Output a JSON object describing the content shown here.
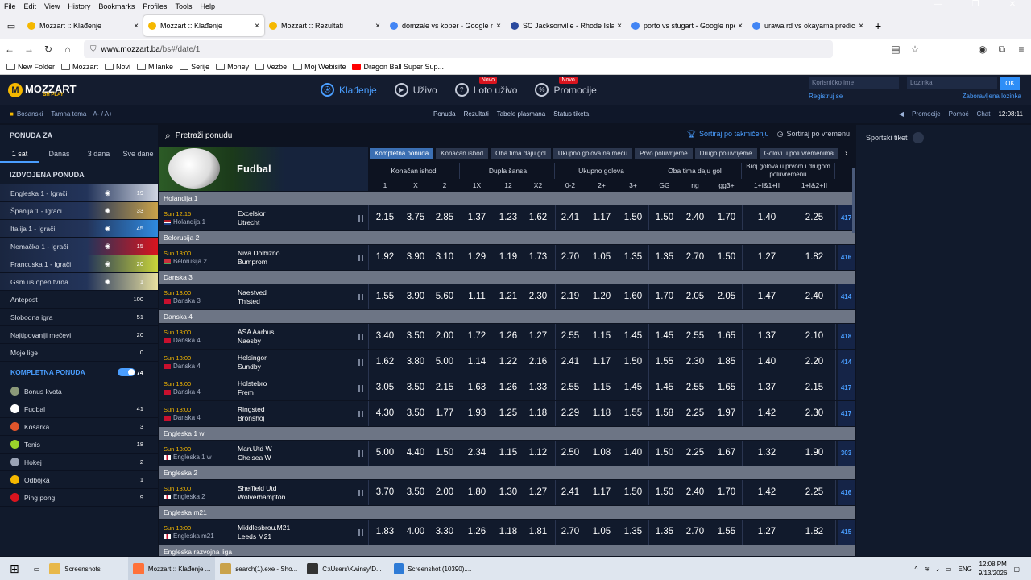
{
  "browser": {
    "menu": [
      "File",
      "Edit",
      "View",
      "History",
      "Bookmarks",
      "Profiles",
      "Tools",
      "Help"
    ],
    "tabs": [
      {
        "title": "Mozzart :: Klađenje",
        "color": "#f5b800"
      },
      {
        "title": "Mozzart :: Klađenje",
        "color": "#f5b800",
        "active": true
      },
      {
        "title": "Mozzart :: Rezultati",
        "color": "#f5b800"
      },
      {
        "title": "domzale vs koper - Google nper",
        "color": "#4285f4"
      },
      {
        "title": "SC Jacksonville - Rhode Island F",
        "color": "#2b4a9e"
      },
      {
        "title": "porto vs stugart - Google nperj",
        "color": "#4285f4"
      },
      {
        "title": "urawa rd vs okayama prediction",
        "color": "#4285f4"
      }
    ],
    "url_host": "www.mozzart.ba",
    "url_path": "/bs#/date/1",
    "bookmarks": [
      "New Folder",
      "Mozzart",
      "Novi",
      "Milanke",
      "Serije",
      "Money",
      "Vezbe",
      "Moj Webisite",
      "Dragon Ball Super Sup..."
    ]
  },
  "site": {
    "logo": "MOZZART",
    "logo_sub": "BH PLAY",
    "nav": [
      {
        "label": "Klađenje",
        "active": true,
        "novo": false
      },
      {
        "label": "Uživo",
        "active": false,
        "novo": false
      },
      {
        "label": "Loto uživo",
        "active": false,
        "novo": true
      },
      {
        "label": "Promocije",
        "active": false,
        "novo": true
      }
    ],
    "novo_label": "Novo",
    "username_placeholder": "Korisničko ime",
    "password_placeholder": "Lozinka",
    "ok": "OK",
    "register": "Registruj se",
    "forgot": "Zaboravljena lozinka",
    "lang": "Bosanski",
    "theme": "Tamna tema",
    "font_size": "A- / A+",
    "subnav": [
      "Ponuda",
      "Rezultati",
      "Tabele plasmana",
      "Status tiketa"
    ],
    "right_links": [
      "Promocije",
      "Pomoć",
      "Chat"
    ],
    "clock": "12:08:11"
  },
  "sidebar": {
    "title": "PONUDA ZA",
    "periods": [
      "1 sat",
      "Danas",
      "3 dana",
      "Sve dane"
    ],
    "featured_title": "IZDVOJENA PONUDA",
    "featured": [
      {
        "label": "Engleska 1 - Igrači",
        "count": "19"
      },
      {
        "label": "Španija 1 - Igrači",
        "count": "33"
      },
      {
        "label": "Italija 1 - Igrači",
        "count": "45"
      },
      {
        "label": "Nemačka 1 - Igrači",
        "count": "15"
      },
      {
        "label": "Francuska 1 - Igrači",
        "count": "20"
      },
      {
        "label": "Gsm us open tvrda",
        "count": "1"
      },
      {
        "label": "Antepost",
        "count": "100"
      },
      {
        "label": "Slobodna igra",
        "count": "51"
      },
      {
        "label": "Najtipovaniji mečevi",
        "count": "20"
      },
      {
        "label": "Moje lige",
        "count": "0"
      }
    ],
    "full_title": "KOMPLETNA PONUDA",
    "full_count": "74",
    "sports": [
      {
        "label": "Bonus kvota",
        "count": "",
        "color": "#8c9a7a"
      },
      {
        "label": "Fudbal",
        "count": "41",
        "color": "#ffffff"
      },
      {
        "label": "Košarka",
        "count": "3",
        "color": "#e0552b"
      },
      {
        "label": "Tenis",
        "count": "18",
        "color": "#9bd32b"
      },
      {
        "label": "Hokej",
        "count": "2",
        "color": "#9aa3b5"
      },
      {
        "label": "Odbojka",
        "count": "1",
        "color": "#f5b800"
      },
      {
        "label": "Ping pong",
        "count": "9",
        "color": "#d9141e"
      }
    ]
  },
  "main": {
    "search": "Pretraži ponudu",
    "sort1": "Sortiraj po takmičenju",
    "sort2": "Sortiraj po vremenu",
    "sport": "Fudbal",
    "markets": [
      "Kompletna ponuda",
      "Konačan ishod",
      "Oba tima daju gol",
      "Ukupno golova na meču",
      "Prvo poluvrijeme",
      "Drugo poluvrijeme",
      "Golovi u poluvremenima"
    ],
    "groups": [
      "Konačan ishod",
      "Dupla šansa",
      "Ukupno golova",
      "Oba tima daju gol",
      "Broj golova u prvom i drugom poluvremenu"
    ],
    "cols": [
      "1",
      "X",
      "2",
      "1X",
      "12",
      "X2",
      "0-2",
      "2+",
      "3+",
      "GG",
      "ng",
      "gg3+",
      "1+I&1+II",
      "1+I&2+II"
    ],
    "leagues": [
      {
        "name": "Holandija 1",
        "events": [
          {
            "time": "Sun 12:15",
            "league": "Holandija 1",
            "flag": "nl",
            "home": "Excelsior",
            "away": "Utrecht",
            "odds": [
              "2.15",
              "3.75",
              "2.85",
              "1.37",
              "1.23",
              "1.62",
              "2.41",
              "1.17",
              "1.50",
              "1.50",
              "2.40",
              "1.70",
              "1.40",
              "2.25"
            ],
            "more": "417"
          }
        ]
      },
      {
        "name": "Belorusija 2",
        "events": [
          {
            "time": "Sun 13:00",
            "league": "Belorusija 2",
            "flag": "by",
            "home": "Niva Dolbizno",
            "away": "Bumprom",
            "odds": [
              "1.92",
              "3.90",
              "3.10",
              "1.29",
              "1.19",
              "1.73",
              "2.70",
              "1.05",
              "1.35",
              "1.35",
              "2.70",
              "1.50",
              "1.27",
              "1.82"
            ],
            "more": "416"
          }
        ]
      },
      {
        "name": "Danska 3",
        "events": [
          {
            "time": "Sun 13:00",
            "league": "Danska 3",
            "flag": "dk",
            "home": "Naestved",
            "away": "Thisted",
            "odds": [
              "1.55",
              "3.90",
              "5.60",
              "1.11",
              "1.21",
              "2.30",
              "2.19",
              "1.20",
              "1.60",
              "1.70",
              "2.05",
              "2.05",
              "1.47",
              "2.40"
            ],
            "more": "414"
          }
        ]
      },
      {
        "name": "Danska 4",
        "events": [
          {
            "time": "Sun 13:00",
            "league": "Danska 4",
            "flag": "dk",
            "home": "ASA Aarhus",
            "away": "Naesby",
            "odds": [
              "3.40",
              "3.50",
              "2.00",
              "1.72",
              "1.26",
              "1.27",
              "2.55",
              "1.15",
              "1.45",
              "1.45",
              "2.55",
              "1.65",
              "1.37",
              "2.10"
            ],
            "more": "418"
          },
          {
            "time": "Sun 13:00",
            "league": "Danska 4",
            "flag": "dk",
            "home": "Helsingor",
            "away": "Sundby",
            "odds": [
              "1.62",
              "3.80",
              "5.00",
              "1.14",
              "1.22",
              "2.16",
              "2.41",
              "1.17",
              "1.50",
              "1.55",
              "2.30",
              "1.85",
              "1.40",
              "2.20"
            ],
            "more": "414"
          },
          {
            "time": "Sun 13:00",
            "league": "Danska 4",
            "flag": "dk",
            "home": "Holstebro",
            "away": "Frem",
            "odds": [
              "3.05",
              "3.50",
              "2.15",
              "1.63",
              "1.26",
              "1.33",
              "2.55",
              "1.15",
              "1.45",
              "1.45",
              "2.55",
              "1.65",
              "1.37",
              "2.15"
            ],
            "more": "417"
          },
          {
            "time": "Sun 13:00",
            "league": "Danska 4",
            "flag": "dk",
            "home": "Ringsted",
            "away": "Bronshoj",
            "odds": [
              "4.30",
              "3.50",
              "1.77",
              "1.93",
              "1.25",
              "1.18",
              "2.29",
              "1.18",
              "1.55",
              "1.58",
              "2.25",
              "1.97",
              "1.42",
              "2.30"
            ],
            "more": "417"
          }
        ]
      },
      {
        "name": "Engleska 1 w",
        "events": [
          {
            "time": "Sun 13:00",
            "league": "Engleska 1 w",
            "flag": "en",
            "home": "Man.Utd W",
            "away": "Chelsea W",
            "odds": [
              "5.00",
              "4.40",
              "1.50",
              "2.34",
              "1.15",
              "1.12",
              "2.50",
              "1.08",
              "1.40",
              "1.50",
              "2.25",
              "1.67",
              "1.32",
              "1.90"
            ],
            "more": "303"
          }
        ]
      },
      {
        "name": "Engleska 2",
        "events": [
          {
            "time": "Sun 13:00",
            "league": "Engleska 2",
            "flag": "en",
            "home": "Sheffield Utd",
            "away": "Wolverhampton",
            "odds": [
              "3.70",
              "3.50",
              "2.00",
              "1.80",
              "1.30",
              "1.27",
              "2.41",
              "1.17",
              "1.50",
              "1.50",
              "2.40",
              "1.70",
              "1.42",
              "2.25"
            ],
            "more": "416"
          }
        ]
      },
      {
        "name": "Engleska m21",
        "events": [
          {
            "time": "Sun 13:00",
            "league": "Engleska m21",
            "flag": "en",
            "home": "Middlesbrou.M21",
            "away": "Leeds M21",
            "odds": [
              "1.83",
              "4.00",
              "3.30",
              "1.26",
              "1.18",
              "1.81",
              "2.70",
              "1.05",
              "1.35",
              "1.35",
              "2.70",
              "1.55",
              "1.27",
              "1.82"
            ],
            "more": "415"
          }
        ]
      },
      {
        "name": "Engleska razvojna liga",
        "events": []
      }
    ]
  },
  "right": {
    "title": "Sportski tiket"
  },
  "taskbar": {
    "items": [
      "Screenshots",
      "Mozzart :: Klađenje ...",
      "search(1).exe - Sho...",
      "C:\\Users\\Kwinsy\\D...",
      "Screenshot (10390)...."
    ],
    "lang": "ENG",
    "time": "12:08 PM",
    "date": "9/13/2026"
  }
}
